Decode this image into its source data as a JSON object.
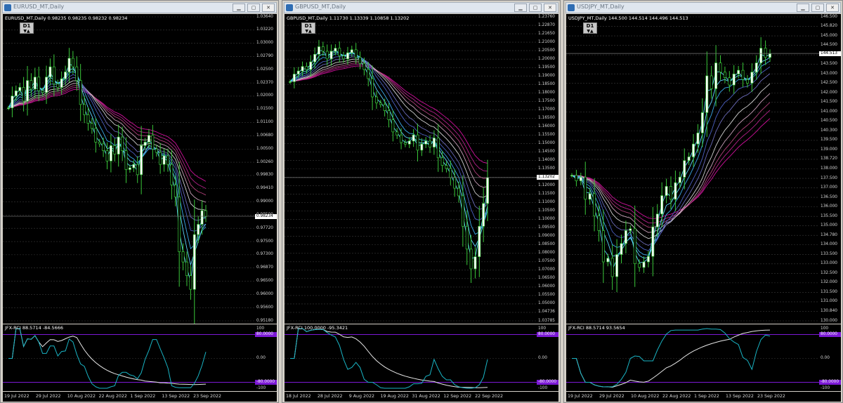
{
  "colors": {
    "candle_up": "#3ac83a",
    "candle_body": "#ffffff",
    "ma_cyan": "#5fd8ff",
    "ma_blue": "#4a5fc0",
    "ma_white": "#d0d0d0",
    "ma_magenta": "#d0109c",
    "rci_line": "#19b4c4",
    "rci_slow": "#e8e8e8",
    "level_purple": "#7c19d6"
  },
  "icons": {
    "window": "chart-window-icon",
    "minimize": "minimize-icon",
    "maximize": "maximize-icon",
    "close": "close-icon"
  },
  "charts": [
    {
      "title": "EURUSD_MT,Daily",
      "header": "EURUSD_MT,Daily  0.98235 0.98235 0.98232 0.98234",
      "timeframe": "D1",
      "timeframe_arrows": "▼▲",
      "price_labels": [
        "1.03640",
        "1.03220",
        "1.03000",
        "1.02790",
        "1.02500",
        "1.02370",
        "1.02000",
        "1.01500",
        "1.01100",
        "1.00680",
        "1.00500",
        "1.00260",
        "0.99830",
        "0.99410",
        "0.99000",
        "0.98500",
        "0.97720",
        "0.97500",
        "0.97300",
        "0.96870",
        "0.96500",
        "0.96000",
        "0.95600",
        "0.95180"
      ],
      "price_tag": "0.98234",
      "rci_title": "JFX-RCI 88.5714 -84.5666",
      "rci_scale": {
        "top": "100",
        "top_level": "80.0000",
        "mid": "0.00",
        "bottom_level": "-80.0000",
        "bottom": "-100"
      },
      "x_labels": [
        "19 Jul 2022",
        "29 Jul 2022",
        "10 Aug 2022",
        "22 Aug 2022",
        "1 Sep 2022",
        "13 Sep 2022",
        "23 Sep 2022"
      ],
      "chart_data": {
        "type": "candlestick",
        "symbol": "EURUSD_MT",
        "ylim": [
          0.9518,
          1.0406
        ],
        "last_price": 0.98234,
        "closes": [
          1.014,
          1.0175,
          1.019,
          1.02,
          1.016,
          1.022,
          1.0195,
          1.023,
          1.019,
          1.0185,
          1.023,
          1.026,
          1.021,
          1.02,
          1.0225,
          1.0245,
          1.0285,
          1.026,
          1.022,
          1.015,
          1.012,
          1.0095,
          1.008,
          1.004,
          1.0035,
          1.0015,
          0.9985,
          1.003,
          1.0005,
          1.0055,
          1.0015,
          0.996,
          0.9965,
          0.9975,
          0.9945,
          1.003,
          1.004,
          1.006,
          1.002,
          1.001,
          0.9975,
          1.0,
          0.9975,
          0.9915,
          0.988,
          0.972,
          0.969,
          0.965,
          0.961,
          0.977,
          0.98,
          0.984,
          0.9823
        ]
      }
    },
    {
      "title": "GBPUSD_MT,Daily",
      "header": "GBPUSD_MT,Daily  1.11730 1.13339 1.10858 1.13202",
      "timeframe": "D1",
      "timeframe_arrows": "▼▲",
      "price_labels": [
        "1.23760",
        "1.22870",
        "1.21650",
        "1.21000",
        "1.20500",
        "1.20000",
        "1.19500",
        "1.19000",
        "1.18500",
        "1.18000",
        "1.17500",
        "1.17000",
        "1.16500",
        "1.16000",
        "1.15500",
        "1.15000",
        "1.14500",
        "1.14000",
        "1.13500",
        "1.12620",
        "1.12000",
        "1.11500",
        "1.11000",
        "1.10500",
        "1.10000",
        "1.09500",
        "1.09000",
        "1.08500",
        "1.08000",
        "1.07500",
        "1.07000",
        "1.06500",
        "1.06000",
        "1.05500",
        "1.05000",
        "1.04736",
        "1.03785"
      ],
      "price_tag": "1.13202",
      "rci_title": "JFX-RCI 100.0000 -95.3421",
      "rci_scale": {
        "top": "100",
        "top_level": "80.0000",
        "mid": "0.00",
        "bottom_level": "-80.0000",
        "bottom": "-100"
      },
      "x_labels": [
        "18 Jul 2022",
        "28 Jul 2022",
        "9 Aug 2022",
        "19 Aug 2022",
        "31 Aug 2022",
        "12 Sep 2022",
        "22 Sep 2022"
      ],
      "chart_data": {
        "type": "candlestick",
        "symbol": "GBPUSD_MT",
        "ylim": [
          1.03785,
          1.2376
        ],
        "last_price": 1.13202,
        "closes": [
          1.195,
          1.2,
          1.202,
          1.205,
          1.203,
          1.208,
          1.213,
          1.218,
          1.215,
          1.21,
          1.215,
          1.217,
          1.212,
          1.21,
          1.214,
          1.216,
          1.211,
          1.207,
          1.203,
          1.197,
          1.185,
          1.181,
          1.18,
          1.176,
          1.17,
          1.162,
          1.16,
          1.155,
          1.154,
          1.156,
          1.16,
          1.15,
          1.154,
          1.156,
          1.152,
          1.158,
          1.145,
          1.14,
          1.138,
          1.132,
          1.125,
          1.12,
          1.1,
          1.085,
          1.072,
          1.08,
          1.1,
          1.115,
          1.132
        ]
      }
    },
    {
      "title": "USDJPY_MT,Daily",
      "header": "USDJPY_MT,Daily  144.500 144.514 144.496 144.513",
      "timeframe": "D1",
      "timeframe_arrows": "▼▲",
      "price_labels": [
        "146.500",
        "145.820",
        "145.000",
        "144.500",
        "144.240",
        "143.500",
        "143.000",
        "142.500",
        "142.000",
        "141.500",
        "141.000",
        "140.500",
        "140.300",
        "139.500",
        "139.000",
        "138.720",
        "138.000",
        "137.500",
        "137.000",
        "136.500",
        "136.000",
        "135.500",
        "135.000",
        "134.780",
        "134.000",
        "133.500",
        "133.000",
        "132.500",
        "132.000",
        "131.500",
        "131.000",
        "130.840",
        "130.000"
      ],
      "price_tag": "144.513",
      "rci_title": "JFX-RCI 88.5714 93.5654",
      "rci_scale": {
        "top": "100",
        "top_level": "80.0000",
        "mid": "0.00",
        "bottom_level": "-80.0000",
        "bottom": "-100"
      },
      "x_labels": [
        "19 Jul 2022",
        "29 Jul 2022",
        "10 Aug 2022",
        "22 Aug 2022",
        "1 Sep 2022",
        "13 Sep 2022",
        "23 Sep 2022"
      ],
      "chart_data": {
        "type": "candlestick",
        "symbol": "USDJPY_MT",
        "ylim": [
          130.0,
          146.5
        ],
        "last_price": 144.513,
        "closes": [
          137.9,
          137.6,
          137.8,
          136.6,
          136.9,
          135.7,
          134.9,
          133.2,
          133.4,
          132.4,
          133.6,
          134.2,
          134.9,
          135.0,
          133.1,
          132.9,
          133.2,
          133.5,
          135.1,
          135.8,
          136.8,
          137.3,
          136.6,
          137.5,
          137.8,
          138.7,
          138.9,
          139.6,
          140.2,
          141.3,
          143.3,
          142.6,
          144.0,
          143.5,
          143.2,
          142.8,
          143.4,
          143.6,
          143.1,
          142.9,
          143.5,
          144.0,
          144.8,
          144.3,
          144.5
        ]
      }
    }
  ]
}
